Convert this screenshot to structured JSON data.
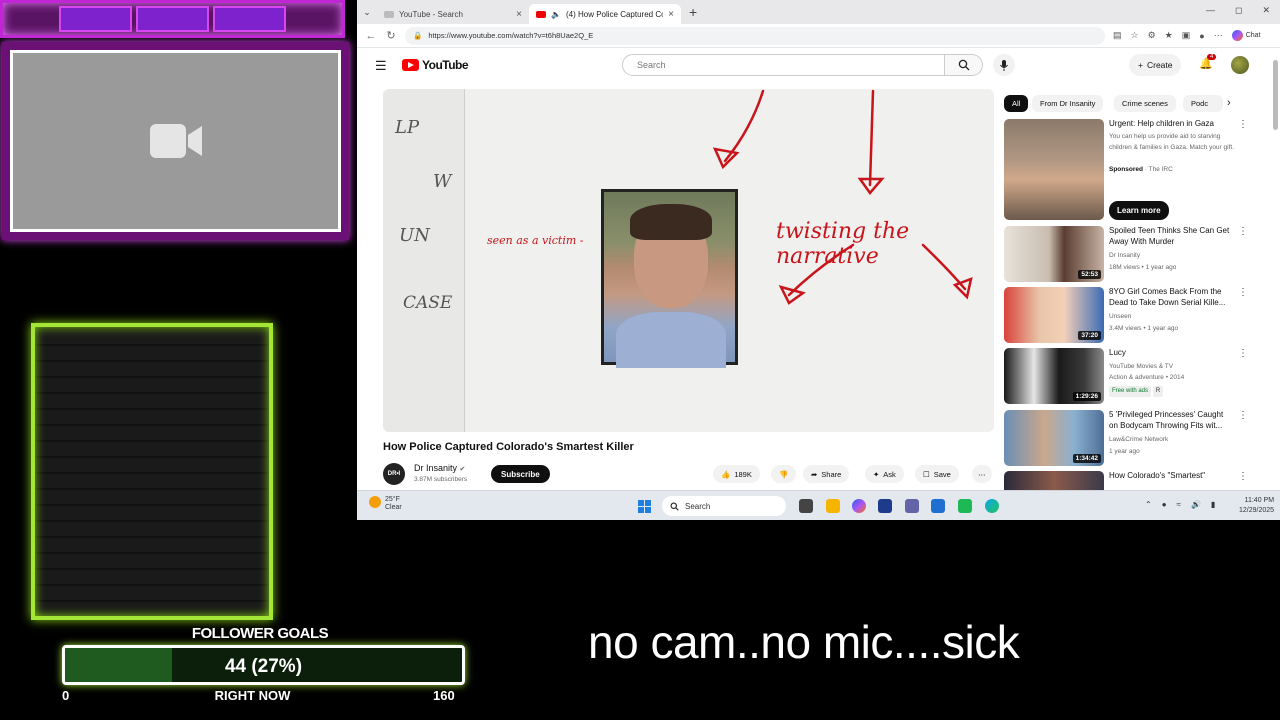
{
  "overlay": {
    "caption": "no cam..no mic....sick",
    "follower_goals": {
      "title": "FOLLOWER GOALS",
      "current_label": "44 (27%)",
      "progress_fraction": 0.27,
      "min": "0",
      "max": "160",
      "sub": "RIGHT NOW"
    }
  },
  "browser": {
    "tabs": [
      {
        "title": "YouTube - Search"
      },
      {
        "title": "(4) How Police Captured Colo"
      }
    ],
    "url": "https://www.youtube.com/watch?v=t6h8Uae2Q_E",
    "chat_label": "Chat"
  },
  "youtube": {
    "logo": "YouTube",
    "search_placeholder": "Search",
    "create_label": "Create",
    "notifications": "4",
    "video": {
      "title": "How Police Captured Colorado's Smartest Killer",
      "handwriting_left": [
        "LP",
        "W",
        "UN",
        "CASE"
      ],
      "handwriting_red_1": "seen as a victim -",
      "handwriting_red_2": "twisting the narrative"
    },
    "channel": {
      "name": "Dr Insanity",
      "subs": "3.87M subscribers",
      "avatar_text": "DR•I"
    },
    "subscribe_label": "Subscribe",
    "actions": {
      "likes": "189K",
      "share": "Share",
      "ask": "Ask",
      "save": "Save"
    },
    "chips": [
      "All",
      "From Dr Insanity",
      "Crime scenes",
      "Podc"
    ],
    "recommendations": [
      {
        "title": "Urgent: Help children in Gaza",
        "desc": "You can help us provide aid to starving children & families in Gaza. Match your gift.",
        "sponsor": "Sponsored",
        "sponsor_name": "The IRC",
        "cta": "Learn more"
      },
      {
        "title": "Spoiled Teen Thinks She Can Get Away With Murder",
        "channel": "Dr Insanity",
        "meta": "18M views • 1 year ago",
        "duration": "52:53"
      },
      {
        "title": "8YO Girl Comes Back From the Dead to Take Down Serial Kille...",
        "channel": "Unseen",
        "meta": "3.4M views • 1 year ago",
        "duration": "37:20"
      },
      {
        "title": "Lucy",
        "channel": "YouTube Movies & TV",
        "meta": "Action & adventure • 2014",
        "extra": "Free with ads",
        "rating": "R",
        "duration": "1:29:26"
      },
      {
        "title": "5 'Privileged Princesses' Caught on Bodycam Throwing Fits wit...",
        "channel": "Law&Crime Network",
        "meta": "1 year ago",
        "duration": "1:34:42"
      },
      {
        "title": "How Colorado's \"Smartest\"",
        "channel": "",
        "meta": "",
        "duration": ""
      }
    ]
  },
  "taskbar": {
    "temp": "25°F",
    "condition": "Clear",
    "search": "Search",
    "time": "11:40 PM",
    "date": "12/29/2025"
  }
}
